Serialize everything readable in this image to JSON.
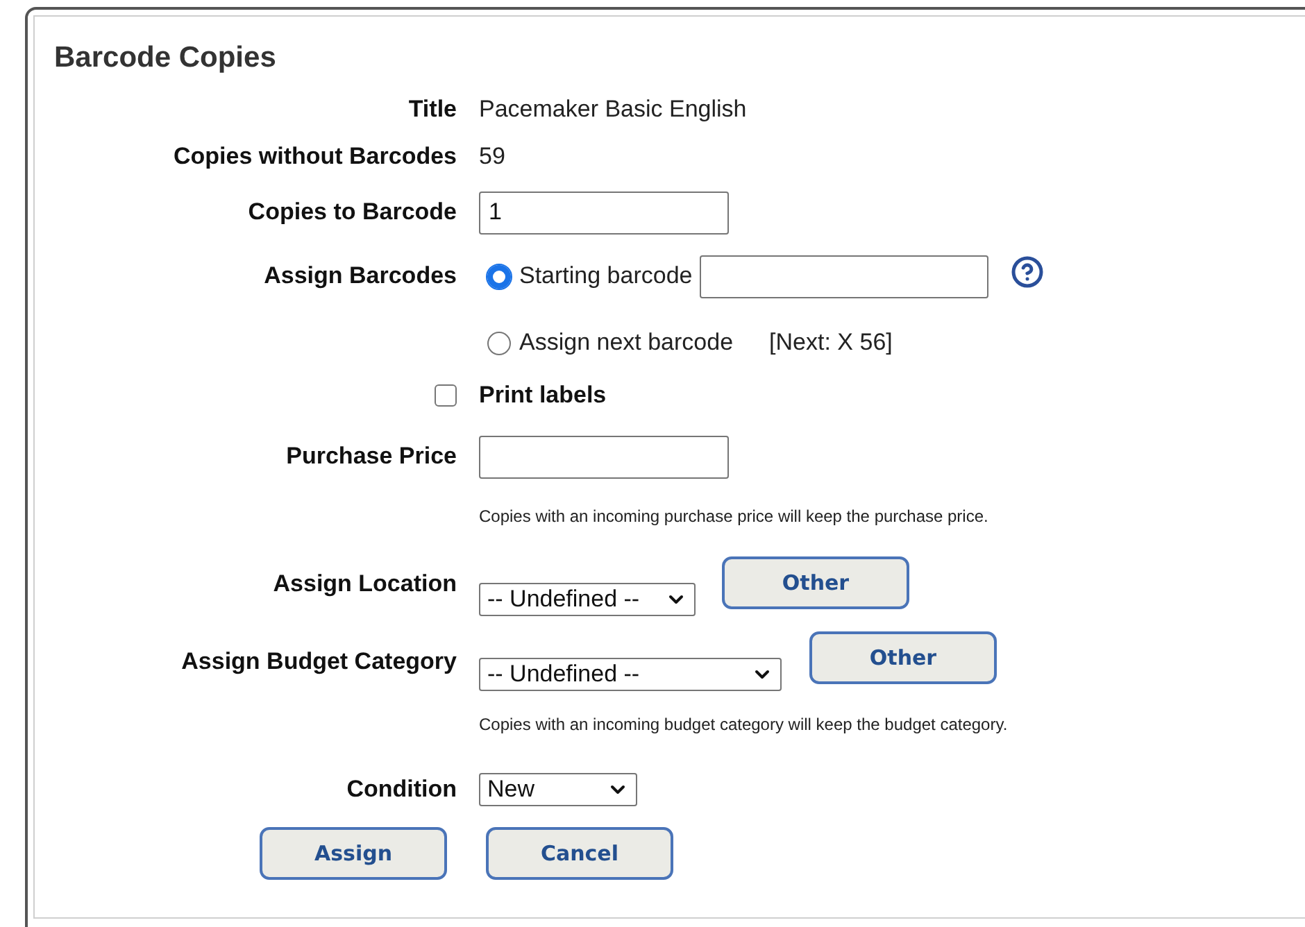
{
  "heading": "Barcode Copies",
  "title_row": {
    "label": "Title",
    "value": "Pacemaker Basic English"
  },
  "copies_without": {
    "label": "Copies without Barcodes",
    "value": "59"
  },
  "copies_to_barcode": {
    "label": "Copies to Barcode",
    "value": "1"
  },
  "assign_barcodes": {
    "label": "Assign Barcodes",
    "options": [
      {
        "label": "Starting barcode",
        "selected": true
      },
      {
        "label": "Assign next barcode",
        "selected": false,
        "note": "[Next: X 56]"
      }
    ]
  },
  "print_labels": {
    "label": "Print labels",
    "checked": false
  },
  "purchase_price": {
    "label": "Purchase Price",
    "note": "Copies with an incoming purchase price will keep the purchase price."
  },
  "location": {
    "label": "Assign Location",
    "value": "-- Undefined --",
    "button": "Other"
  },
  "budget": {
    "label": "Assign Budget Category",
    "value": "-- Undefined --",
    "button": "Other",
    "note": "Copies with an incoming budget category will keep the budget category."
  },
  "condition": {
    "label": "Condition",
    "value": "New"
  },
  "buttons": [
    "Assign",
    "Cancel"
  ]
}
